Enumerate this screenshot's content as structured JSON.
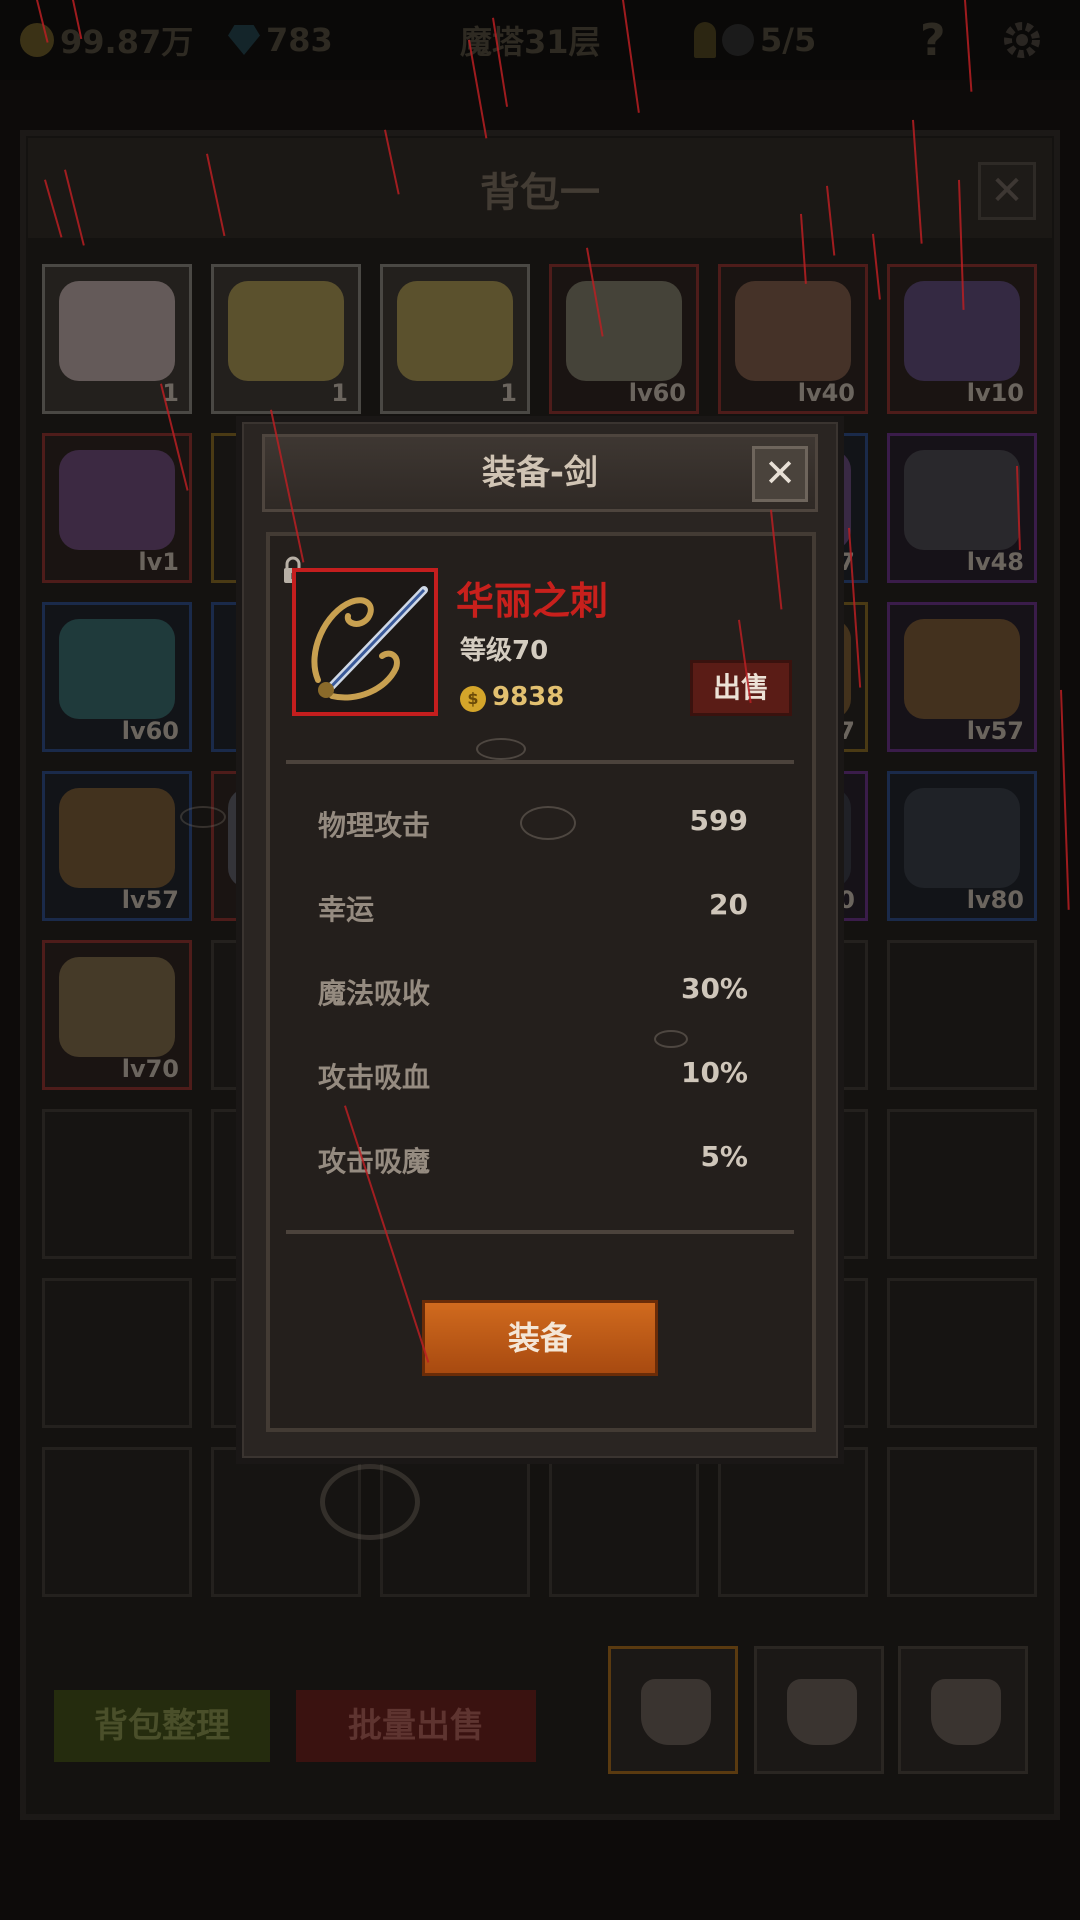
{
  "top_bar": {
    "gold": "99.87万",
    "gems": "783",
    "floor": "魔塔31层",
    "keys": "5/5",
    "help_label": "?"
  },
  "bag": {
    "title": "背包一",
    "close_label": "✕",
    "slots": [
      {
        "label": "1",
        "border": "gray",
        "icon": "cake-icon"
      },
      {
        "label": "1",
        "border": "gray",
        "icon": "beer-mug-icon"
      },
      {
        "label": "1",
        "border": "gray",
        "icon": "beer-mug-icon"
      },
      {
        "label": "lv60",
        "border": "red",
        "icon": "dagger-icon"
      },
      {
        "label": "lv40",
        "border": "red",
        "icon": "trident-icon"
      },
      {
        "label": "lv10",
        "border": "red",
        "icon": "shield-icon"
      },
      {
        "label": "lv1",
        "border": "red",
        "icon": "ring-icon"
      },
      {
        "label": "",
        "border": "gold",
        "icon": ""
      },
      {
        "label": "",
        "border": "blue",
        "icon": ""
      },
      {
        "label": "",
        "border": "red",
        "icon": ""
      },
      {
        "label": "7",
        "border": "blue",
        "icon": "ring-icon"
      },
      {
        "label": "lv48",
        "border": "purple",
        "icon": "helmet-icon"
      },
      {
        "label": "lv60",
        "border": "blue",
        "icon": "orb-icon"
      },
      {
        "label": "",
        "border": "blue",
        "icon": ""
      },
      {
        "label": "",
        "border": "blue",
        "icon": ""
      },
      {
        "label": "",
        "border": "red",
        "icon": ""
      },
      {
        "label": "7",
        "border": "gold",
        "icon": "bracelet-icon"
      },
      {
        "label": "lv57",
        "border": "purple",
        "icon": "bracelet-icon"
      },
      {
        "label": "lv57",
        "border": "blue",
        "icon": "bracelet-icon"
      },
      {
        "label": "",
        "border": "red",
        "icon": "sword-icon"
      },
      {
        "label": "",
        "border": "blue",
        "icon": ""
      },
      {
        "label": "",
        "border": "red",
        "icon": ""
      },
      {
        "label": "0",
        "border": "purple",
        "icon": "armor-icon"
      },
      {
        "label": "lv80",
        "border": "blue",
        "icon": "armor-icon"
      },
      {
        "label": "lv70",
        "border": "red",
        "icon": "bow-blade-icon"
      }
    ],
    "sort_button": "背包整理",
    "bulk_sell_button": "批量出售"
  },
  "modal": {
    "title": "装备-剑",
    "close_label": "✕",
    "item_name": "华丽之刺",
    "item_level": "等级70",
    "price": "9838",
    "price_icon": "$",
    "sell_button": "出售",
    "stats": [
      {
        "name": "物理攻击",
        "value": "599"
      },
      {
        "name": "幸运",
        "value": "20"
      },
      {
        "name": "魔法吸收",
        "value": "30%"
      },
      {
        "name": "攻击吸血",
        "value": "10%"
      },
      {
        "name": "攻击吸魔",
        "value": "5%"
      }
    ],
    "equip_button": "装备"
  },
  "colors": {
    "item_name": "#c8201c",
    "rarity_red": "#c41e1e",
    "equip_button": "#c0601a",
    "rain": "#b81e22"
  }
}
